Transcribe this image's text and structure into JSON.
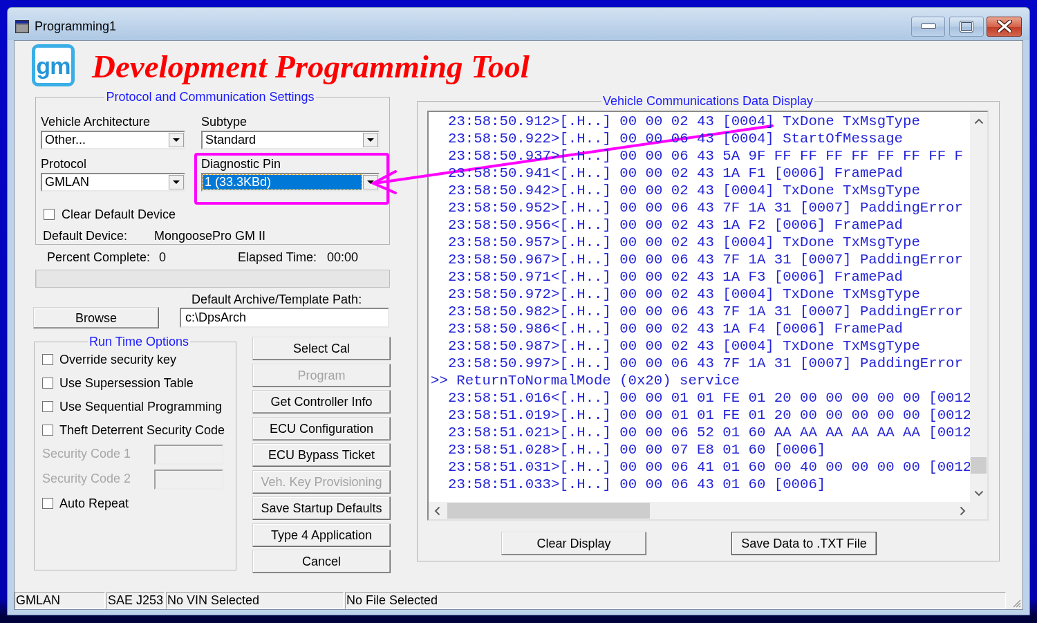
{
  "window": {
    "title": "Programming1"
  },
  "header": {
    "logo": "gm",
    "title": "Development Programming Tool"
  },
  "protocol_settings": {
    "legend": "Protocol and Communication Settings",
    "dropdowns": [
      {
        "label": "Vehicle Architecture",
        "value": "Other...",
        "focused": false,
        "annotated": false
      },
      {
        "label": "Subtype",
        "value": "Standard",
        "focused": false,
        "annotated": false
      },
      {
        "label": "Protocol",
        "value": "GMLAN",
        "focused": false,
        "annotated": false
      },
      {
        "label": "Diagnostic Pin",
        "value": "1 (33.3KBd)",
        "focused": true,
        "annotated": true
      }
    ],
    "clear_default_device": {
      "label": "Clear Default Device",
      "checked": false
    },
    "default_device": {
      "label": "Default Device:",
      "value": "MongoosePro GM II"
    }
  },
  "progress": {
    "percent_label": "Percent Complete:",
    "percent_value": "0",
    "elapsed_label": "Elapsed Time:",
    "elapsed_value": "00:00",
    "level": 0
  },
  "archive": {
    "browse_button": "Browse",
    "path_label": "Default Archive/Template Path:",
    "path_value": "c:\\DpsArch"
  },
  "run_time_options": {
    "legend": "Run Time Options",
    "items": [
      {
        "kind": "checkbox",
        "label": "Override security key",
        "checked": false,
        "disabled": false
      },
      {
        "kind": "checkbox",
        "label": "Use Supersession Table",
        "checked": false,
        "disabled": false
      },
      {
        "kind": "checkbox",
        "label": "Use Sequential Programming",
        "checked": false,
        "disabled": false
      },
      {
        "kind": "checkbox",
        "label": "Theft Deterrent Security Code",
        "checked": false,
        "disabled": false
      },
      {
        "kind": "code",
        "label": "Security Code 1",
        "disabled": true
      },
      {
        "kind": "code",
        "label": "Security Code 2",
        "disabled": true
      },
      {
        "kind": "checkbox",
        "label": "Auto Repeat",
        "checked": false,
        "disabled": false
      }
    ]
  },
  "actions": [
    {
      "label": "Select Cal",
      "disabled": false
    },
    {
      "label": "Program",
      "disabled": true
    },
    {
      "label": "Get Controller Info",
      "disabled": false
    },
    {
      "label": "ECU Configuration",
      "disabled": false
    },
    {
      "label": "ECU Bypass Ticket",
      "disabled": false
    },
    {
      "label": "Veh. Key Provisioning",
      "disabled": true
    },
    {
      "label": "Save Startup Defaults",
      "disabled": false
    },
    {
      "label": "Type 4 Application",
      "disabled": false
    },
    {
      "label": "Cancel",
      "disabled": false
    }
  ],
  "data_display": {
    "legend": "Vehicle Communications Data Display",
    "lines": [
      {
        "kind": "entry",
        "text": "23:58:50.912>[.H..] 00 00 02 43 [0004] TxDone TxMsgType"
      },
      {
        "kind": "entry",
        "text": "23:58:50.922>[.H..] 00 00 06 43 [0004] StartOfMessage"
      },
      {
        "kind": "entry",
        "text": "23:58:50.937>[.H..] 00 00 06 43 5A 9F FF FF FF FF FF FF FF F"
      },
      {
        "kind": "entry",
        "text": "23:58:50.941<[.H..] 00 00 02 43 1A F1 [0006] FramePad"
      },
      {
        "kind": "entry",
        "text": "23:58:50.942>[.H..] 00 00 02 43 [0004] TxDone TxMsgType"
      },
      {
        "kind": "entry",
        "text": "23:58:50.952>[.H..] 00 00 06 43 7F 1A 31 [0007] PaddingError"
      },
      {
        "kind": "entry",
        "text": "23:58:50.956<[.H..] 00 00 02 43 1A F2 [0006] FramePad"
      },
      {
        "kind": "entry",
        "text": "23:58:50.957>[.H..] 00 00 02 43 [0004] TxDone TxMsgType"
      },
      {
        "kind": "entry",
        "text": "23:58:50.967>[.H..] 00 00 06 43 7F 1A 31 [0007] PaddingError"
      },
      {
        "kind": "entry",
        "text": "23:58:50.971<[.H..] 00 00 02 43 1A F3 [0006] FramePad"
      },
      {
        "kind": "entry",
        "text": "23:58:50.972>[.H..] 00 00 02 43 [0004] TxDone TxMsgType"
      },
      {
        "kind": "entry",
        "text": "23:58:50.982>[.H..] 00 00 06 43 7F 1A 31 [0007] PaddingError"
      },
      {
        "kind": "entry",
        "text": "23:58:50.986<[.H..] 00 00 02 43 1A F4 [0006] FramePad"
      },
      {
        "kind": "entry",
        "text": "23:58:50.987>[.H..] 00 00 02 43 [0004] TxDone TxMsgType"
      },
      {
        "kind": "entry",
        "text": "23:58:50.997>[.H..] 00 00 06 43 7F 1A 31 [0007] PaddingError"
      },
      {
        "kind": "service",
        "text": ">> ReturnToNormalMode (0x20) service"
      },
      {
        "kind": "entry",
        "text": "23:58:51.016<[.H..] 00 00 01 01 FE 01 20 00 00 00 00 00 [0012"
      },
      {
        "kind": "entry",
        "text": "23:58:51.019>[.H..] 00 00 01 01 FE 01 20 00 00 00 00 00 [0012"
      },
      {
        "kind": "entry",
        "text": "23:58:51.021>[.H..] 00 00 06 52 01 60 AA AA AA AA AA AA [0012"
      },
      {
        "kind": "entry",
        "text": "23:58:51.028>[.H..] 00 00 07 E8 01 60 [0006]"
      },
      {
        "kind": "entry",
        "text": "23:58:51.031>[.H..] 00 00 06 41 01 60 00 40 00 00 00 00 [0012"
      },
      {
        "kind": "entry",
        "text": "23:58:51.033>[.H..] 00 00 06 43 01 60 [0006]"
      }
    ],
    "buttons": [
      {
        "label": "Clear Display",
        "is_default": false
      },
      {
        "label": "Save Data to .TXT File",
        "is_default": true
      }
    ]
  },
  "status_bar": [
    "GMLAN",
    "SAE J253",
    "No VIN Selected",
    "No File Selected"
  ]
}
